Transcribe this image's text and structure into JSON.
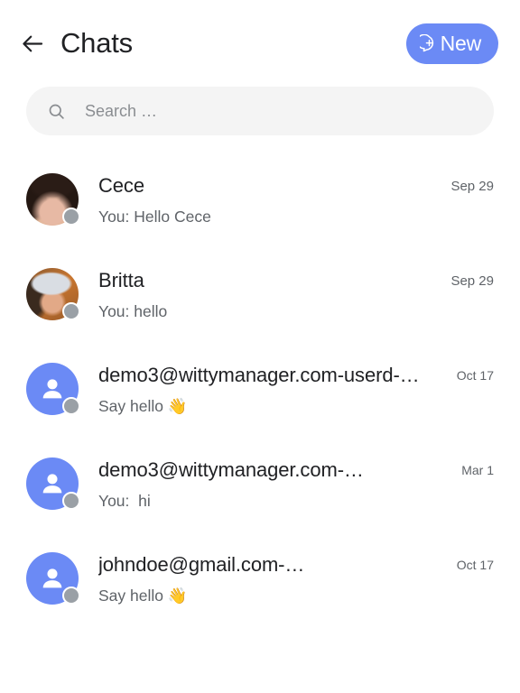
{
  "header": {
    "back_icon": "arrow-left-icon",
    "title": "Chats",
    "new_button": {
      "label": "New",
      "icon": "chat-bubble-plus-icon"
    },
    "accent_color": "#6b8af5"
  },
  "search": {
    "icon": "search-icon",
    "value": "",
    "placeholder": "Search …",
    "background_color": "#f4f4f4"
  },
  "chats": [
    {
      "name": "Cece",
      "preview": "You: Hello Cece",
      "date": "Sep 29",
      "avatar_type": "photo",
      "avatar_style": "photo-cece",
      "status": "offline",
      "status_color": "#9aa0a6"
    },
    {
      "name": "Britta",
      "preview": "You: hello",
      "date": "Sep 29",
      "avatar_type": "photo",
      "avatar_style": "photo-britta",
      "status": "offline",
      "status_color": "#9aa0a6"
    },
    {
      "name": "demo3@wittymanager.com-userd-…",
      "preview": "Say hello 👋",
      "date": "Oct 17",
      "avatar_type": "default",
      "avatar_style": "default",
      "status": "offline",
      "status_color": "#9aa0a6"
    },
    {
      "name": "demo3@wittymanager.com-…",
      "preview": "You:  hi",
      "date": "Mar 1",
      "avatar_type": "default",
      "avatar_style": "default",
      "status": "offline",
      "status_color": "#9aa0a6"
    },
    {
      "name": "johndoe@gmail.com-…",
      "preview": "Say hello 👋",
      "date": "Oct 17",
      "avatar_type": "default",
      "avatar_style": "default",
      "status": "offline",
      "status_color": "#9aa0a6"
    }
  ]
}
